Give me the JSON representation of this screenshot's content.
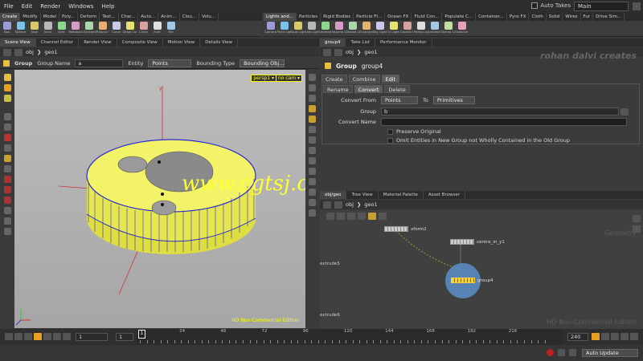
{
  "menubar": {
    "items": [
      "File",
      "Edit",
      "Render",
      "Windows",
      "Help"
    ],
    "auto_takes": "Auto Takes",
    "desktop": "Main"
  },
  "shelf_left": {
    "tabs": [
      "Create",
      "Modify",
      "Model",
      "Poly...",
      "Deform",
      "Text...",
      "Char...",
      "Auto...",
      "Anim...",
      "Clou...",
      "Volu..."
    ],
    "tools": [
      "Box",
      "Sphere",
      "Tube",
      "Torus",
      "Grid",
      "Metaball",
      "LSystem",
      "Platonic So...",
      "Curve",
      "Draw Curve",
      "Circle",
      "Font",
      "File"
    ]
  },
  "shelf_right": {
    "tabs": [
      "Lights and...",
      "Particles",
      "Rigid Bodies",
      "Particle Fl...",
      "Ocean FX",
      "Fluid Con...",
      "Populate C...",
      "Container...",
      "Pyro FX",
      "Cloth",
      "Solid",
      "Wires",
      "Fur",
      "Drive Sim..."
    ],
    "tools": [
      "Camera",
      "Point Light",
      "Spot Light",
      "Area Light",
      "Geometry...",
      "Volume Li...",
      "Distant Light",
      "Environme...",
      "Sky Light",
      "GI Light",
      "Caustic Li...",
      "Portal Light",
      "Ambient Li...",
      "Stereo Ca...",
      "Switcher"
    ]
  },
  "left_pane": {
    "tabs": [
      "Scene View",
      "Channel Editor",
      "Render View",
      "Composite View",
      "Motion View",
      "Details View"
    ],
    "path": [
      "obj",
      "geo1"
    ],
    "op": {
      "node_type": "Group",
      "group_name_label": "Group Name",
      "group_name_value": "a",
      "entity_label": "Entity",
      "entity_value": "Points",
      "bounding_label": "Bounding Type",
      "bounding_value": "Bounding Obj..."
    },
    "viewport": {
      "camera": "persp1 ▾",
      "cam_select": "no cam ▾",
      "edition": "HD Non-Commercial Edition",
      "watermark_site": "www.cgtsj.com"
    }
  },
  "param_pane": {
    "tabs": [
      "group4",
      "Take List",
      "Performance Monitor"
    ],
    "path": [
      "obj",
      "geo1"
    ],
    "node_type": "Group",
    "node_name": "group4",
    "watermark": "rohan dalvi creates",
    "main_tabs": [
      "Create",
      "Combine",
      "Edit"
    ],
    "sub_tabs": [
      "Rename",
      "Convert",
      "Delete"
    ],
    "convert_from_label": "Convert From",
    "convert_from_value": "Points",
    "to_label": "To",
    "to_value": "Primitives",
    "group_label": "Group",
    "group_value": "b",
    "convert_name_label": "Convert Name",
    "convert_name_value": "",
    "preserve_original": "Preserve Original",
    "omit_entities": "Omit Entities in New Group not Wholly Contained in the Old Group"
  },
  "network_pane": {
    "tabs": [
      "obj/geo",
      "Tree View",
      "Material Palette",
      "Asset Browser"
    ],
    "path": [
      "obj",
      "geo1"
    ],
    "context_label": "Geometry",
    "edition": "HD Non-Commercial Edition",
    "nodes": {
      "xform": "xform2",
      "centre": "centre_in_y1",
      "group": "group4",
      "extrude5": "extrude5",
      "extrude6": "extrude6"
    }
  },
  "timeline": {
    "frame_current": "1",
    "frame_start": "1",
    "frame_marker": "1",
    "ticks": [
      "24",
      "48",
      "72",
      "96",
      "120",
      "144",
      "168",
      "192",
      "216"
    ],
    "end_frame": "240",
    "auto_update": "Auto Update"
  },
  "colors": {
    "geometry_yellow": "#f0f04a",
    "wire_blue": "#2a2ad0",
    "viewport_grey": "#b4b4b4",
    "node_selected": "#5a8fc8"
  }
}
